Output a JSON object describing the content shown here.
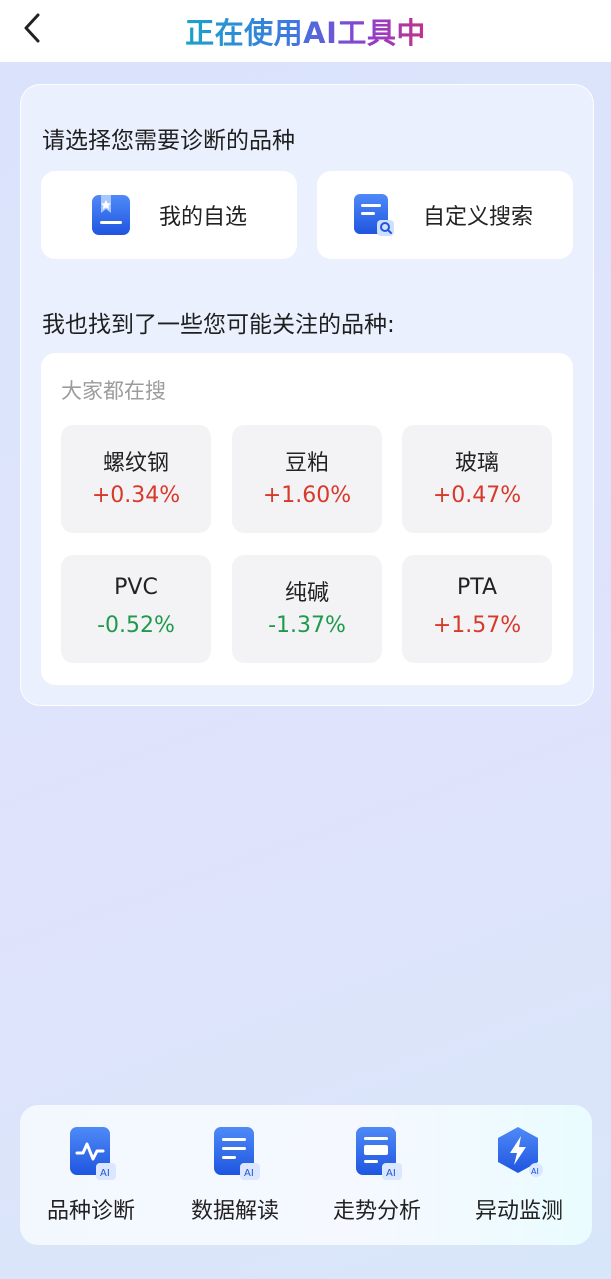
{
  "header": {
    "title": "正在使用AI工具中",
    "back_icon": "chevron-left-icon"
  },
  "prompt_select": "请选择您需要诊断的品种",
  "choices": [
    {
      "label": "我的自选",
      "icon": "bookmark-star-icon"
    },
    {
      "label": "自定义搜索",
      "icon": "document-search-icon"
    }
  ],
  "prompt_suggest": "我也找到了一些您可能关注的品种:",
  "hot": {
    "title": "大家都在搜",
    "items": [
      {
        "name": "螺纹钢",
        "change": "+0.34%",
        "direction": "up"
      },
      {
        "name": "豆粕",
        "change": "+1.60%",
        "direction": "up"
      },
      {
        "name": "玻璃",
        "change": "+0.47%",
        "direction": "up"
      },
      {
        "name": "PVC",
        "change": "-0.52%",
        "direction": "down"
      },
      {
        "name": "纯碱",
        "change": "-1.37%",
        "direction": "down"
      },
      {
        "name": "PTA",
        "change": "+1.57%",
        "direction": "up"
      }
    ]
  },
  "tools": [
    {
      "label": "品种诊断",
      "icon": "pulse-ai-icon"
    },
    {
      "label": "数据解读",
      "icon": "document-ai-icon"
    },
    {
      "label": "走势分析",
      "icon": "report-ai-icon"
    },
    {
      "label": "异动监测",
      "icon": "lightning-hexagon-icon"
    }
  ],
  "colors": {
    "up": "#d8392b",
    "down": "#1f9a4c",
    "accent": "#2a62e8"
  }
}
